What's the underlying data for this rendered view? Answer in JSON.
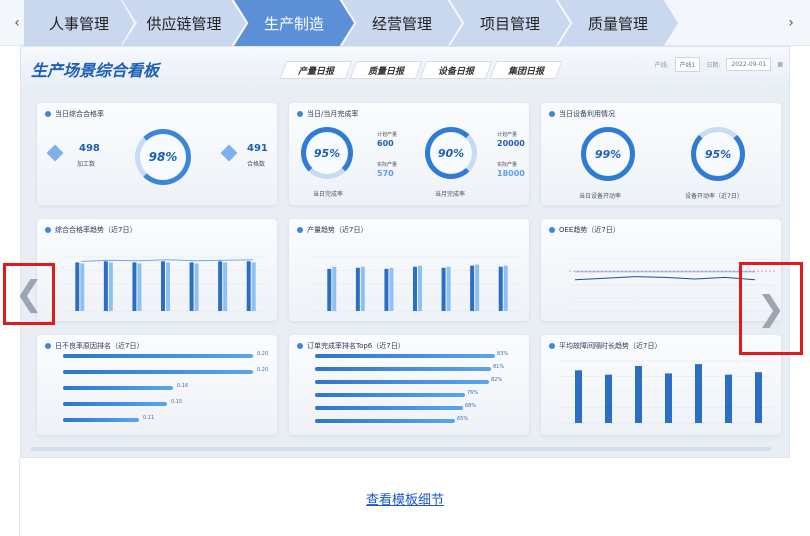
{
  "tabbar": {
    "prev_arrow": "‹",
    "next_arrow": "›",
    "tabs": [
      "人事管理",
      "供应链管理",
      "生产制造",
      "经营管理",
      "项目管理",
      "质量管理"
    ],
    "active_index": 2
  },
  "dashboard": {
    "title": "生产场景综合看板",
    "report_tabs": [
      "产量日报",
      "质量日报",
      "设备日报",
      "集团日报"
    ],
    "filters": {
      "line_label": "产线:",
      "line_value": "产线1",
      "date_label": "日期:",
      "date_value": "2022-09-01"
    },
    "cards": {
      "pass_rate": {
        "title": "当日综合合格率",
        "processed_value": "498",
        "processed_label": "加工数",
        "passed_value": "491",
        "passed_label": "合格数",
        "rate": "98%"
      },
      "completion": {
        "title": "当日/当月完成率",
        "day_rate": "95%",
        "month_rate": "90%",
        "day_plan_label": "计划产量",
        "day_plan": "600",
        "day_actual_label": "实际产量",
        "day_actual": "570",
        "month_plan_label": "计划产量",
        "month_plan": "20000",
        "month_actual_label": "实际产量",
        "month_actual": "18000",
        "day_caption": "当日完成率",
        "month_caption": "当月完成率"
      },
      "equipment": {
        "title": "当日设备利用情况",
        "rate1": "99%",
        "caption1": "当日设备开动率",
        "rate2": "95%",
        "caption2": "设备开动率（近7日）"
      },
      "trend": {
        "title": "综合合格率趋势（近7日）"
      },
      "output": {
        "title": "产量趋势（近7日）"
      },
      "oee": {
        "title": "OEE趋势（近7日）"
      },
      "defects": {
        "title": "日不良率原因排名（近7日）",
        "values": [
          "0.20",
          "0.20",
          "0.16",
          "0.15",
          "0.11"
        ]
      },
      "orders": {
        "title": "订单完成率排名Top6（近7日）",
        "values": [
          "83%",
          "81%",
          "82%",
          "76%",
          "68%",
          "65%"
        ]
      },
      "repair": {
        "title": "平均故障间隔时长趋势（近7日）"
      }
    }
  },
  "navigation": {
    "prev_symbol": "❮",
    "next_symbol": "❯"
  },
  "detail_link": "查看模板细节",
  "colors": {
    "accent": "#5b8fd6",
    "highlight": "#e01b1b",
    "link": "#1a57c9"
  }
}
